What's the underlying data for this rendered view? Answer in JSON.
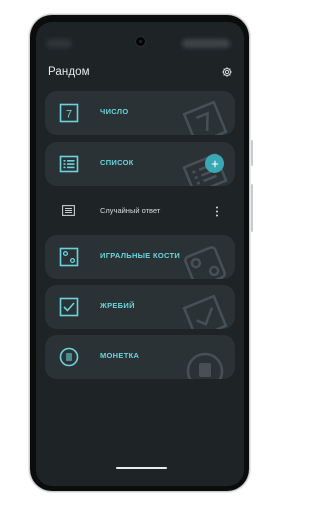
{
  "app": {
    "title": "Рандом"
  },
  "colors": {
    "accent": "#69d4dd",
    "card_background": "#2b3235",
    "screen_background": "#1e2326",
    "fab": "#39a8b5"
  },
  "cards": [
    {
      "label": "ЧИСЛО",
      "icon": "number-seven-icon"
    },
    {
      "label": "СПИСОК",
      "icon": "list-icon"
    },
    {
      "label": "ИГРАЛЬНЫЕ КОСТИ",
      "icon": "dice-icon"
    },
    {
      "label": "ЖРЕБИЙ",
      "icon": "checkbox-icon"
    },
    {
      "label": "МОНЕТКА",
      "icon": "coin-icon"
    }
  ],
  "number_icon_digit": "7",
  "list_items": [
    {
      "label": "Случайный ответ",
      "icon": "list-item-icon"
    }
  ],
  "fab": {
    "icon": "plus-icon"
  },
  "settings": {
    "icon": "gear-icon"
  }
}
